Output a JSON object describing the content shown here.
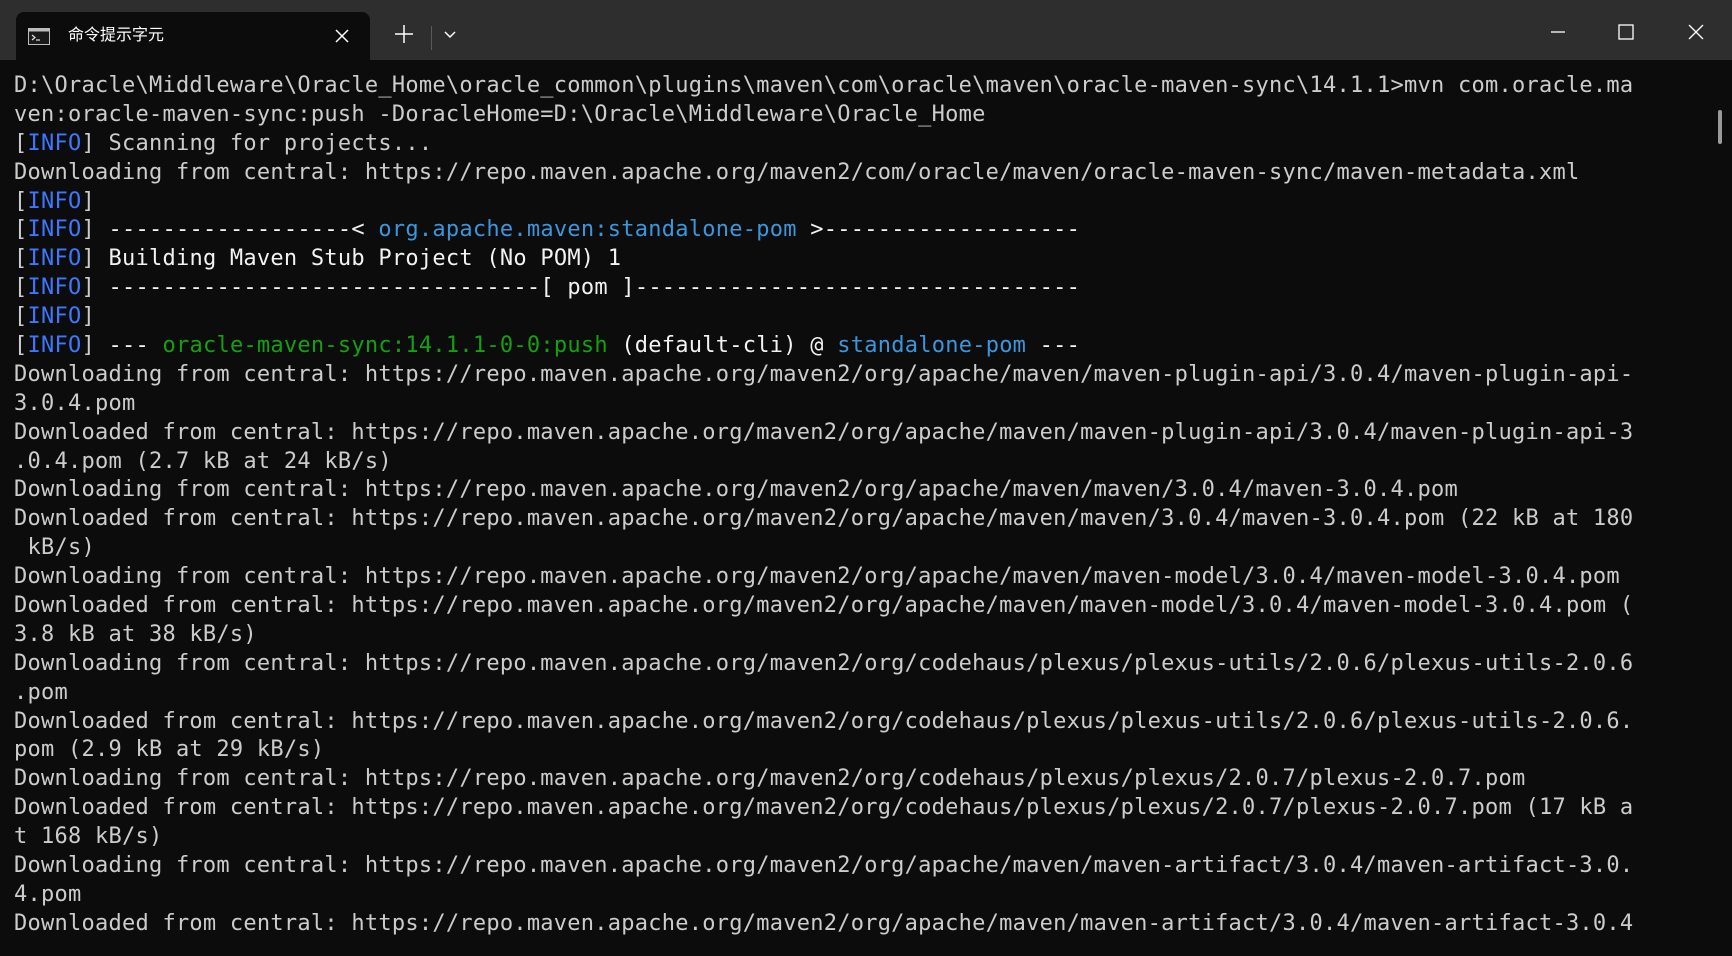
{
  "window": {
    "tab_title": "命令提示字元"
  },
  "icons": {
    "tab": "terminal-icon",
    "close_tab": "close-icon",
    "new_tab": "plus-icon",
    "dropdown": "chevron-down-icon",
    "minimize": "minimize-icon",
    "maximize": "maximize-icon",
    "close_window": "close-icon"
  },
  "colors": {
    "background": "#0c0c0c",
    "titlebar": "#2e2e2e",
    "text": "#cccccc",
    "info": "#3b78ff",
    "blue": "#3a96dd",
    "green": "#13a10e"
  },
  "terminal": {
    "lines": [
      "D:\\Oracle\\Middleware\\Oracle_Home\\oracle_common\\plugins\\maven\\com\\oracle\\maven\\oracle-maven-sync\\14.1.1>mvn com.oracle.ma",
      "ven:oracle-maven-sync:push -DoracleHome=D:\\Oracle\\Middleware\\Oracle_Home",
      "[INFO] Scanning for projects...",
      "Downloading from central: https://repo.maven.apache.org/maven2/com/oracle/maven/oracle-maven-sync/maven-metadata.xml",
      "[INFO]",
      "[INFO] ------------------< org.apache.maven:standalone-pom >-------------------",
      "[INFO] Building Maven Stub Project (No POM) 1",
      "[INFO] --------------------------------[ pom ]---------------------------------",
      "[INFO]",
      "[INFO] --- oracle-maven-sync:14.1.1-0-0:push (default-cli) @ standalone-pom ---",
      "Downloading from central: https://repo.maven.apache.org/maven2/org/apache/maven/maven-plugin-api/3.0.4/maven-plugin-api-",
      "3.0.4.pom",
      "Downloaded from central: https://repo.maven.apache.org/maven2/org/apache/maven/maven-plugin-api/3.0.4/maven-plugin-api-3",
      ".0.4.pom (2.7 kB at 24 kB/s)",
      "Downloading from central: https://repo.maven.apache.org/maven2/org/apache/maven/maven/3.0.4/maven-3.0.4.pom",
      "Downloaded from central: https://repo.maven.apache.org/maven2/org/apache/maven/maven/3.0.4/maven-3.0.4.pom (22 kB at 180",
      " kB/s)",
      "Downloading from central: https://repo.maven.apache.org/maven2/org/apache/maven/maven-model/3.0.4/maven-model-3.0.4.pom",
      "Downloaded from central: https://repo.maven.apache.org/maven2/org/apache/maven/maven-model/3.0.4/maven-model-3.0.4.pom (",
      "3.8 kB at 38 kB/s)",
      "Downloading from central: https://repo.maven.apache.org/maven2/org/codehaus/plexus/plexus-utils/2.0.6/plexus-utils-2.0.6",
      ".pom",
      "Downloaded from central: https://repo.maven.apache.org/maven2/org/codehaus/plexus/plexus-utils/2.0.6/plexus-utils-2.0.6.",
      "pom (2.9 kB at 29 kB/s)",
      "Downloading from central: https://repo.maven.apache.org/maven2/org/codehaus/plexus/plexus/2.0.7/plexus-2.0.7.pom",
      "Downloaded from central: https://repo.maven.apache.org/maven2/org/codehaus/plexus/plexus/2.0.7/plexus-2.0.7.pom (17 kB a",
      "t 168 kB/s)",
      "Downloading from central: https://repo.maven.apache.org/maven2/org/apache/maven/maven-artifact/3.0.4/maven-artifact-3.0.",
      "4.pom",
      "Downloaded from central: https://repo.maven.apache.org/maven2/org/apache/maven/maven-artifact/3.0.4/maven-artifact-3.0.4"
    ],
    "highlights": {
      "info": "INFO",
      "pom_id": "org.apache.maven:standalone-pom",
      "pom": "pom",
      "goal": "oracle-maven-sync:14.1.1-0-0:push",
      "cli": "(default-cli)",
      "project": "standalone-pom"
    }
  }
}
